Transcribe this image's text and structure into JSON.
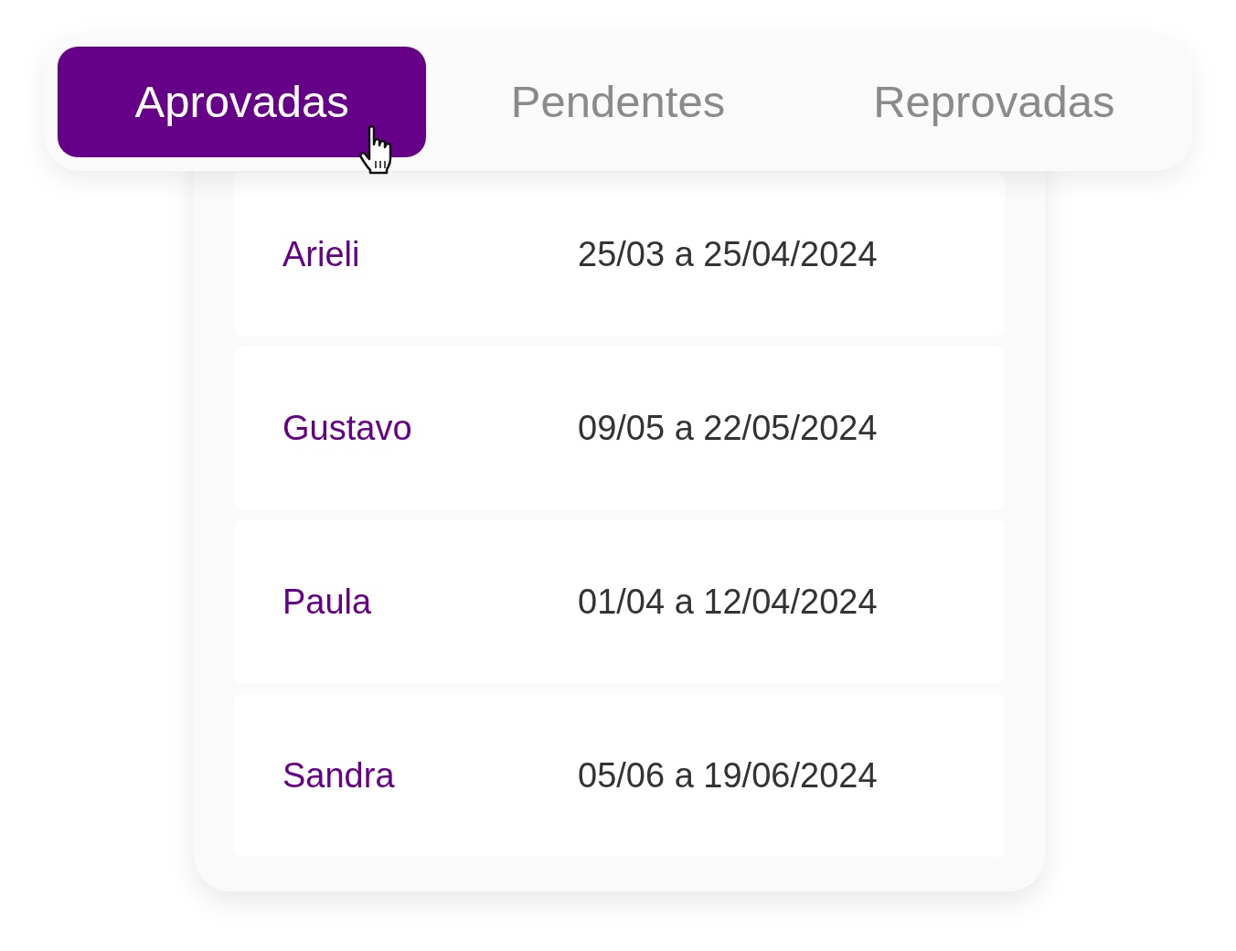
{
  "tabs": [
    {
      "label": "Aprovadas",
      "selected": true
    },
    {
      "label": "Pendentes",
      "selected": false
    },
    {
      "label": "Reprovadas",
      "selected": false
    }
  ],
  "rows": [
    {
      "name": "Arieli",
      "period": "25/03 a 25/04/2024"
    },
    {
      "name": "Gustavo",
      "period": "09/05 a 22/05/2024"
    },
    {
      "name": "Paula",
      "period": "01/04 a 12/04/2024"
    },
    {
      "name": "Sandra",
      "period": "05/06 a 19/06/2024"
    }
  ]
}
